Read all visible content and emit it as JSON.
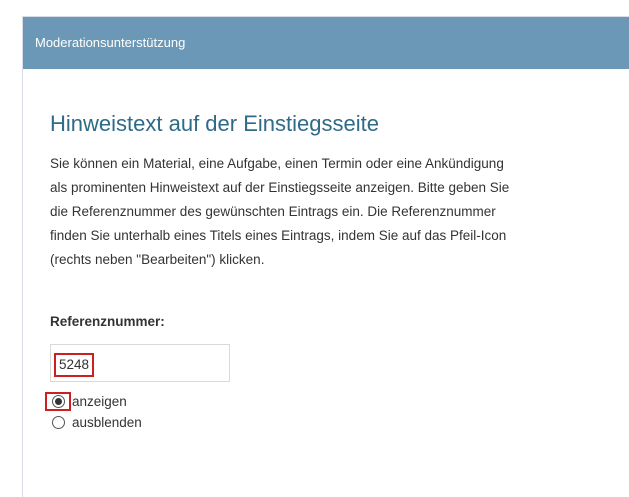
{
  "header": {
    "title": "Moderationsunterstützung"
  },
  "section": {
    "title": "Hinweistext auf der Einstiegsseite",
    "description_lines": [
      "Sie können ein Material, eine Aufgabe, einen Termin oder eine Ankündigung",
      "als prominenten Hinweistext auf der Einstiegsseite anzeigen. Bitte geben Sie",
      "die Referenznummer des gewünschten Eintrags ein. Die Referenznummer",
      "finden Sie unterhalb eines Titels eines Eintrags, indem Sie auf das Pfeil-Icon",
      "(rechts neben \"Bearbeiten\") klicken."
    ]
  },
  "form": {
    "reference_label": "Referenznummer:",
    "reference_value": "5248",
    "visibility_options": [
      {
        "label": "anzeigen",
        "selected": true
      },
      {
        "label": "ausblenden",
        "selected": false
      }
    ]
  },
  "colors": {
    "header_bg": "#6a98b6",
    "title": "#2f6a88",
    "highlight": "#cc1f1f"
  }
}
